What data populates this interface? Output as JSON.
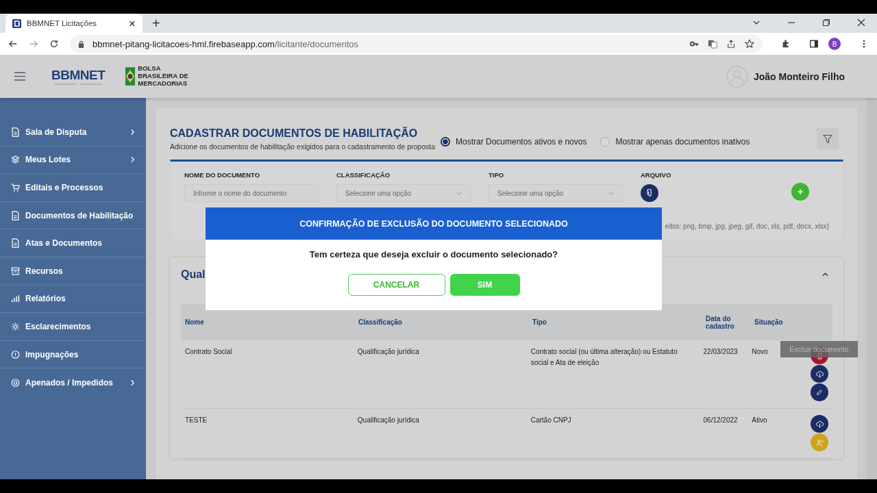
{
  "browser": {
    "tab": {
      "title": "BBMNET Licitações",
      "close": "×"
    },
    "new_tab": "+",
    "url_host": "bbmnet-pitang-licitacoes-hml.firebaseapp.com",
    "url_path": "/licitante/documentos",
    "profile": "B"
  },
  "header": {
    "logo": "BBMNET",
    "partner": "BOLSA BRASILEIRA DE MERCADORIAS",
    "user": "João Monteiro Filho"
  },
  "sidebar": {
    "items": [
      {
        "label": "Sala de Disputa",
        "has_submenu": true
      },
      {
        "label": "Meus Lotes",
        "has_submenu": true
      },
      {
        "label": "Editais e Processos",
        "has_submenu": false
      },
      {
        "label": "Documentos de Habilitação",
        "has_submenu": false
      },
      {
        "label": "Atas e Documentos",
        "has_submenu": false
      },
      {
        "label": "Recursos",
        "has_submenu": false
      },
      {
        "label": "Relatórios",
        "has_submenu": false
      },
      {
        "label": "Esclarecimentos",
        "has_submenu": false
      },
      {
        "label": "Impugnações",
        "has_submenu": false
      },
      {
        "label": "Apenados / Impedidos",
        "has_submenu": true
      }
    ]
  },
  "page": {
    "title": "CADASTRAR DOCUMENTOS DE HABILITAÇÃO",
    "subtitle": "Adicione os documentos de habilitação exigidos para o cadastramento de proposta",
    "filters": [
      {
        "label": "Mostrar Documentos ativos e novos",
        "selected": true
      },
      {
        "label": "Mostrar apenas documentos inativos",
        "selected": false
      }
    ]
  },
  "form": {
    "fields": [
      {
        "kind": "text",
        "label": "NOME DO DOCUMENTO",
        "placeholder": "Informe o nome do documento"
      },
      {
        "kind": "select",
        "label": "CLASSIFICAÇÃO",
        "placeholder": "Selecione uma opção"
      },
      {
        "kind": "select",
        "label": "TIPO",
        "placeholder": "Selecione uma opção"
      },
      {
        "kind": "file",
        "label": "ARQUIVO"
      }
    ],
    "formats_note": "eitos: png, bmp, jpg, jpeg, gif, doc, xls, pdf, docx, xlsx)"
  },
  "section": {
    "title": "Qual",
    "expanded": true
  },
  "table": {
    "columns": [
      "Nome",
      "Classificação",
      "Tipo",
      "Data do cadastro",
      "Situação"
    ],
    "rows": [
      {
        "cells": [
          "Contrato Social",
          "Qualificação jurídica",
          "Contrato social (ou última alteração) ou Estatuto social e Ata de eleição",
          "22/03/2023",
          "Novo"
        ],
        "actions": [
          {
            "kind": "delete"
          },
          {
            "kind": "download"
          },
          {
            "kind": "edit"
          }
        ]
      },
      {
        "cells": [
          "TESTE",
          "Qualificação jurídica",
          "Cartão CNPJ",
          "06/12/2022",
          "Ativo"
        ],
        "actions": [
          {
            "kind": "download"
          },
          {
            "kind": "assign"
          }
        ]
      }
    ]
  },
  "tooltip": "Excluir documento",
  "modal": {
    "title": "CONFIRMAÇÃO DE EXCLUSÃO DO DOCUMENTO SELECIONADO",
    "message": "Tem certeza que deseja excluir o documento selecionado?",
    "buttons": [
      {
        "label": "CANCELAR",
        "kind": "secondary"
      },
      {
        "label": "SIM",
        "kind": "primary"
      }
    ]
  }
}
